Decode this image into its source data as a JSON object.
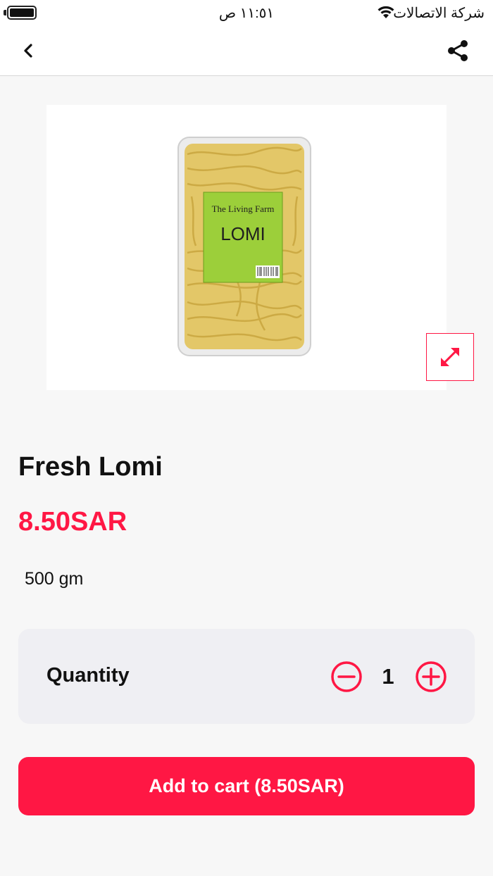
{
  "status_bar": {
    "time": "١١:٥١ ص",
    "carrier": "شركة الاتصالات"
  },
  "nav": {
    "back_icon": "chevron-left-icon",
    "share_icon": "share-icon"
  },
  "product": {
    "image": {
      "brand_text": "The Living Farm",
      "label_text": "LOMI",
      "expand_icon": "expand-arrows-icon"
    },
    "title": "Fresh Lomi",
    "price": "8.50SAR",
    "weight": "500 gm"
  },
  "quantity": {
    "label": "Quantity",
    "value": "1",
    "minus_icon": "minus-circle-icon",
    "plus_icon": "plus-circle-icon"
  },
  "cart": {
    "button_label": "Add to cart (8.50SAR)"
  },
  "colors": {
    "accent": "#ff1744",
    "card_bg": "#efeff3",
    "page_bg": "#f7f7f7"
  }
}
